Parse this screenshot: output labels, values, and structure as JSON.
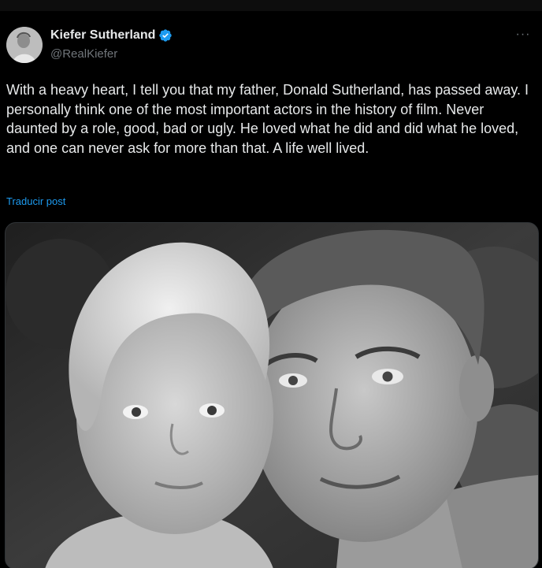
{
  "tweet": {
    "author": {
      "display_name": "Kiefer Sutherland",
      "handle": "@RealKiefer",
      "verified": true,
      "avatar_icon": "profile-photo"
    },
    "more_icon": "ellipsis-icon",
    "text": "With a heavy heart, I tell you that my father, Donald Sutherland, has passed away. I personally think one of the most important actors in the history of film. Never daunted by a role, good, bad or ugly. He loved what he did and did what he loved, and one can never ask for more than that. A life well lived.",
    "translate_label": "Traducir post",
    "media": {
      "type": "photo",
      "style": "black-and-white",
      "subject": "father-and-child-portrait"
    }
  },
  "colors": {
    "background": "#000000",
    "text": "#e7e9ea",
    "muted": "#71767b",
    "link": "#1d9bf0",
    "verified": "#1d9bf0"
  }
}
